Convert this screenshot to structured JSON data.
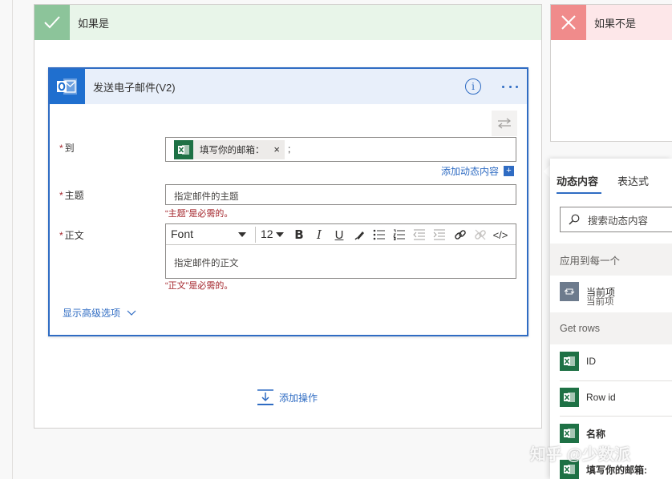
{
  "branches": {
    "yes": {
      "title": "如果是"
    },
    "no": {
      "title": "如果不是"
    }
  },
  "card": {
    "title": "发送电子邮件(V2)",
    "info_glyph": "i"
  },
  "fields": {
    "to": {
      "label": "到",
      "token": "填写你的邮箱：",
      "token_close": "×",
      "separator": ";"
    },
    "add_dynamic": "添加动态内容",
    "subject": {
      "label": "主题",
      "placeholder": "指定邮件的主题",
      "error": "“主题”是必需的。"
    },
    "body": {
      "label": "正文",
      "font": "Font",
      "font_size": "12",
      "placeholder": "指定邮件的正文",
      "error": "“正文”是必需的。",
      "toolbar": {
        "bold": "B",
        "italic": "I",
        "underline": "U",
        "code": "</>"
      }
    },
    "required_mark": "*"
  },
  "show_advanced": "显示高级选项",
  "add_action": "添加操作",
  "panel": {
    "tabs": [
      "动态内容",
      "表达式"
    ],
    "search_placeholder": "搜索动态内容",
    "sections": [
      {
        "title": "应用到每一个",
        "items": [
          {
            "label": "当前项",
            "sub": "当前项",
            "icon": "loop-icon"
          }
        ]
      },
      {
        "title": "Get rows",
        "items": [
          {
            "label": "ID",
            "icon": "excel-icon"
          },
          {
            "label": "Row id",
            "icon": "excel-icon"
          },
          {
            "label": "名称",
            "icon": "excel-icon"
          },
          {
            "label": "填写你的邮箱:",
            "icon": "excel-icon"
          }
        ]
      }
    ]
  },
  "watermark": "知乎 @少数派",
  "colors": {
    "accent": "#2f6cc3",
    "yes_green": "#8cc49a",
    "no_red": "#f08b8b",
    "excel_green": "#1e7145",
    "error": "#a4262c"
  }
}
